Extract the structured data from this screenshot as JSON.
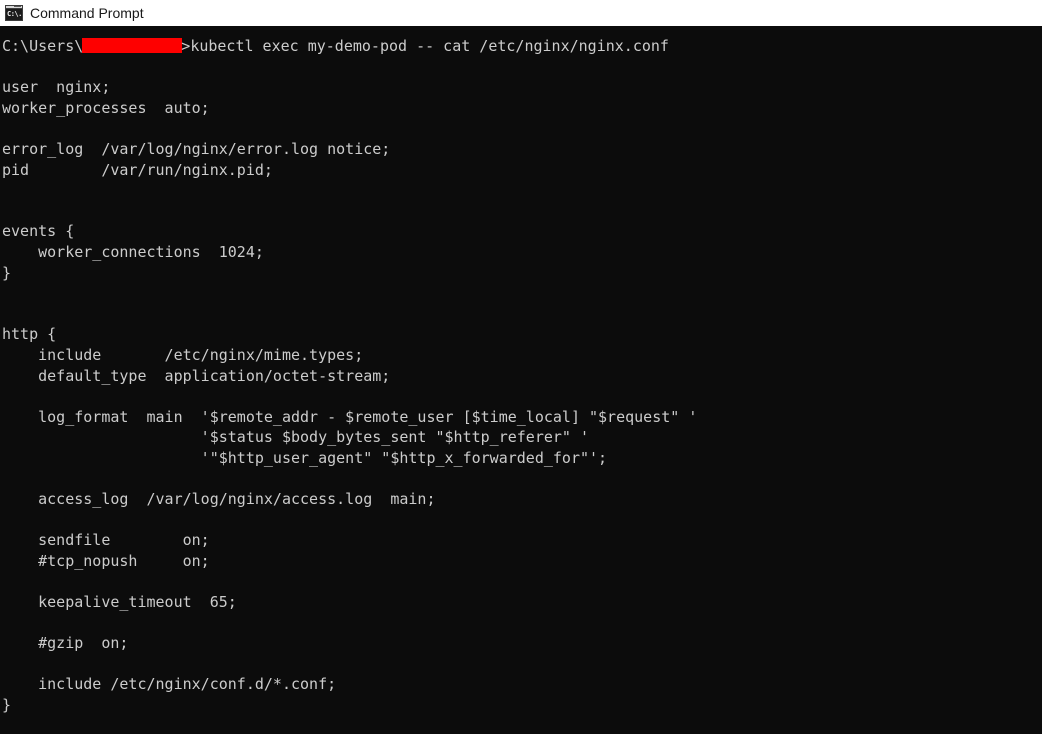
{
  "window": {
    "title": "Command Prompt",
    "icon_name": "cmd-icon",
    "icon_glyph": "C:\\.",
    "titlebar_bg": "#ffffff",
    "titlebar_fg": "#1a1a1a"
  },
  "terminal": {
    "background": "#0c0c0c",
    "foreground": "#cccccc",
    "redaction_color": "#fe0000",
    "prompt_prefix": "C:\\Users\\",
    "prompt_suffix": ">",
    "command": "kubectl exec my-demo-pod -- cat /etc/nginx/nginx.conf",
    "lines": [
      {
        "type": "prompt",
        "prefix": "C:\\Users\\",
        "redacted": true,
        "suffix": ">",
        "command": "kubectl exec my-demo-pod -- cat /etc/nginx/nginx.conf"
      },
      {
        "type": "blank",
        "text": ""
      },
      {
        "type": "text",
        "text": "user  nginx;"
      },
      {
        "type": "text",
        "text": "worker_processes  auto;"
      },
      {
        "type": "blank",
        "text": ""
      },
      {
        "type": "text",
        "text": "error_log  /var/log/nginx/error.log notice;"
      },
      {
        "type": "text",
        "text": "pid        /var/run/nginx.pid;"
      },
      {
        "type": "blank",
        "text": ""
      },
      {
        "type": "blank",
        "text": ""
      },
      {
        "type": "text",
        "text": "events {"
      },
      {
        "type": "text",
        "text": "    worker_connections  1024;"
      },
      {
        "type": "text",
        "text": "}"
      },
      {
        "type": "blank",
        "text": ""
      },
      {
        "type": "blank",
        "text": ""
      },
      {
        "type": "text",
        "text": "http {"
      },
      {
        "type": "text",
        "text": "    include       /etc/nginx/mime.types;"
      },
      {
        "type": "text",
        "text": "    default_type  application/octet-stream;"
      },
      {
        "type": "blank",
        "text": ""
      },
      {
        "type": "text",
        "text": "    log_format  main  '$remote_addr - $remote_user [$time_local] \"$request\" '"
      },
      {
        "type": "text",
        "text": "                      '$status $body_bytes_sent \"$http_referer\" '"
      },
      {
        "type": "text",
        "text": "                      '\"$http_user_agent\" \"$http_x_forwarded_for\"';"
      },
      {
        "type": "blank",
        "text": ""
      },
      {
        "type": "text",
        "text": "    access_log  /var/log/nginx/access.log  main;"
      },
      {
        "type": "blank",
        "text": ""
      },
      {
        "type": "text",
        "text": "    sendfile        on;"
      },
      {
        "type": "text",
        "text": "    #tcp_nopush     on;"
      },
      {
        "type": "blank",
        "text": ""
      },
      {
        "type": "text",
        "text": "    keepalive_timeout  65;"
      },
      {
        "type": "blank",
        "text": ""
      },
      {
        "type": "text",
        "text": "    #gzip  on;"
      },
      {
        "type": "blank",
        "text": ""
      },
      {
        "type": "text",
        "text": "    include /etc/nginx/conf.d/*.conf;"
      },
      {
        "type": "text",
        "text": "}"
      }
    ]
  }
}
